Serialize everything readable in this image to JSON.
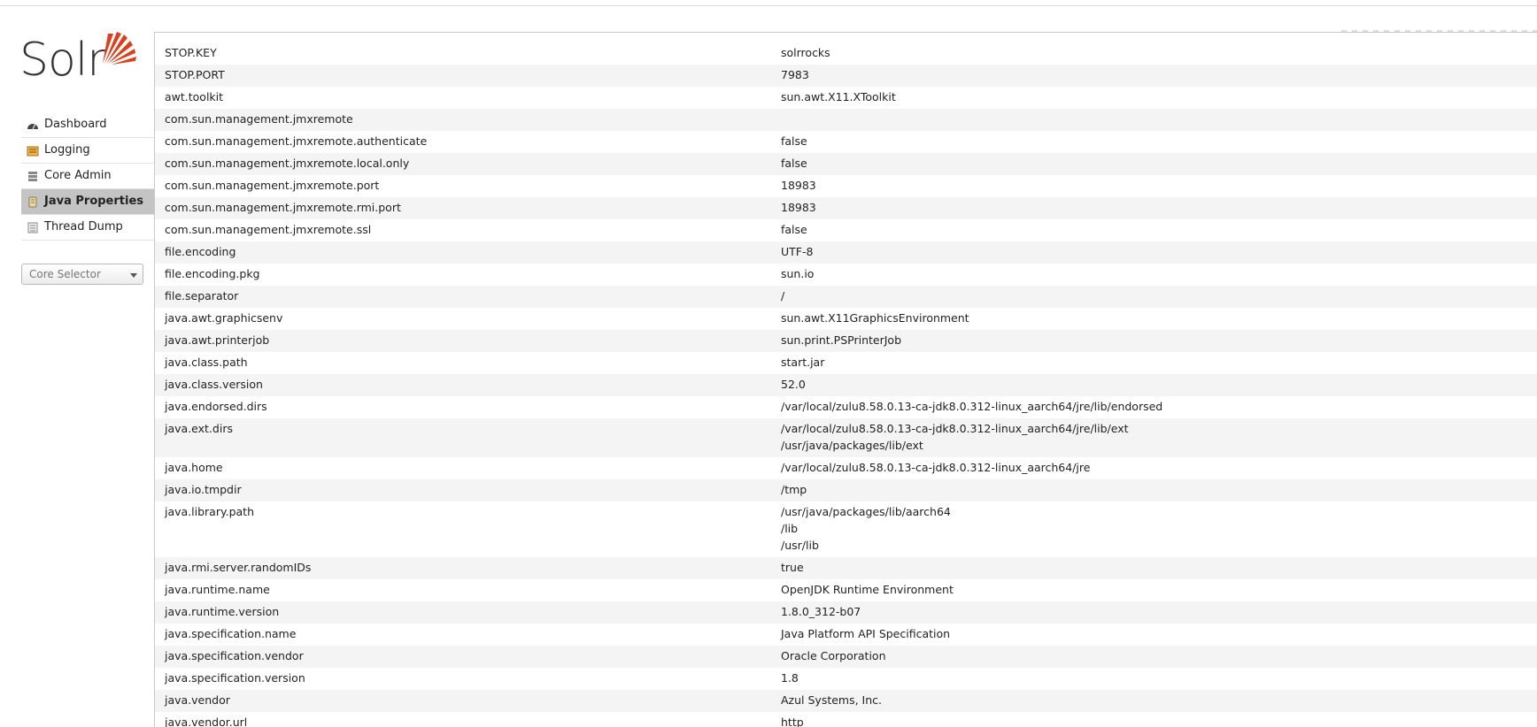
{
  "app": {
    "logo_text": "Solr",
    "accent_color": "#d9411e"
  },
  "sidebar": {
    "items": [
      {
        "label": "Dashboard",
        "icon": "dashboard-icon",
        "active": false
      },
      {
        "label": "Logging",
        "icon": "logging-icon",
        "active": false
      },
      {
        "label": "Core Admin",
        "icon": "core-admin-icon",
        "active": false
      },
      {
        "label": "Java Properties",
        "icon": "java-properties-icon",
        "active": true
      },
      {
        "label": "Thread Dump",
        "icon": "thread-dump-icon",
        "active": false
      }
    ],
    "core_selector": {
      "placeholder": "Core Selector"
    }
  },
  "properties": [
    {
      "key": "STOP.KEY",
      "values": [
        "solrrocks"
      ]
    },
    {
      "key": "STOP.PORT",
      "values": [
        "7983"
      ]
    },
    {
      "key": "awt.toolkit",
      "values": [
        "sun.awt.X11.XToolkit"
      ]
    },
    {
      "key": "com.sun.management.jmxremote",
      "values": [
        ""
      ]
    },
    {
      "key": "com.sun.management.jmxremote.authenticate",
      "values": [
        "false"
      ]
    },
    {
      "key": "com.sun.management.jmxremote.local.only",
      "values": [
        "false"
      ]
    },
    {
      "key": "com.sun.management.jmxremote.port",
      "values": [
        "18983"
      ]
    },
    {
      "key": "com.sun.management.jmxremote.rmi.port",
      "values": [
        "18983"
      ]
    },
    {
      "key": "com.sun.management.jmxremote.ssl",
      "values": [
        "false"
      ]
    },
    {
      "key": "file.encoding",
      "values": [
        "UTF-8"
      ]
    },
    {
      "key": "file.encoding.pkg",
      "values": [
        "sun.io"
      ]
    },
    {
      "key": "file.separator",
      "values": [
        "/"
      ]
    },
    {
      "key": "java.awt.graphicsenv",
      "values": [
        "sun.awt.X11GraphicsEnvironment"
      ]
    },
    {
      "key": "java.awt.printerjob",
      "values": [
        "sun.print.PSPrinterJob"
      ]
    },
    {
      "key": "java.class.path",
      "values": [
        "start.jar"
      ]
    },
    {
      "key": "java.class.version",
      "values": [
        "52.0"
      ]
    },
    {
      "key": "java.endorsed.dirs",
      "values": [
        "/var/local/zulu8.58.0.13-ca-jdk8.0.312-linux_aarch64/jre/lib/endorsed"
      ]
    },
    {
      "key": "java.ext.dirs",
      "values": [
        "/var/local/zulu8.58.0.13-ca-jdk8.0.312-linux_aarch64/jre/lib/ext",
        "/usr/java/packages/lib/ext"
      ]
    },
    {
      "key": "java.home",
      "values": [
        "/var/local/zulu8.58.0.13-ca-jdk8.0.312-linux_aarch64/jre"
      ]
    },
    {
      "key": "java.io.tmpdir",
      "values": [
        "/tmp"
      ]
    },
    {
      "key": "java.library.path",
      "values": [
        "/usr/java/packages/lib/aarch64",
        "/lib",
        "/usr/lib"
      ]
    },
    {
      "key": "java.rmi.server.randomIDs",
      "values": [
        "true"
      ]
    },
    {
      "key": "java.runtime.name",
      "values": [
        "OpenJDK Runtime Environment"
      ]
    },
    {
      "key": "java.runtime.version",
      "values": [
        "1.8.0_312-b07"
      ]
    },
    {
      "key": "java.specification.name",
      "values": [
        "Java Platform API Specification"
      ]
    },
    {
      "key": "java.specification.vendor",
      "values": [
        "Oracle Corporation"
      ]
    },
    {
      "key": "java.specification.version",
      "values": [
        "1.8"
      ]
    },
    {
      "key": "java.vendor",
      "values": [
        "Azul Systems, Inc."
      ]
    },
    {
      "key": "java.vendor.url",
      "values": [
        "http"
      ]
    }
  ]
}
